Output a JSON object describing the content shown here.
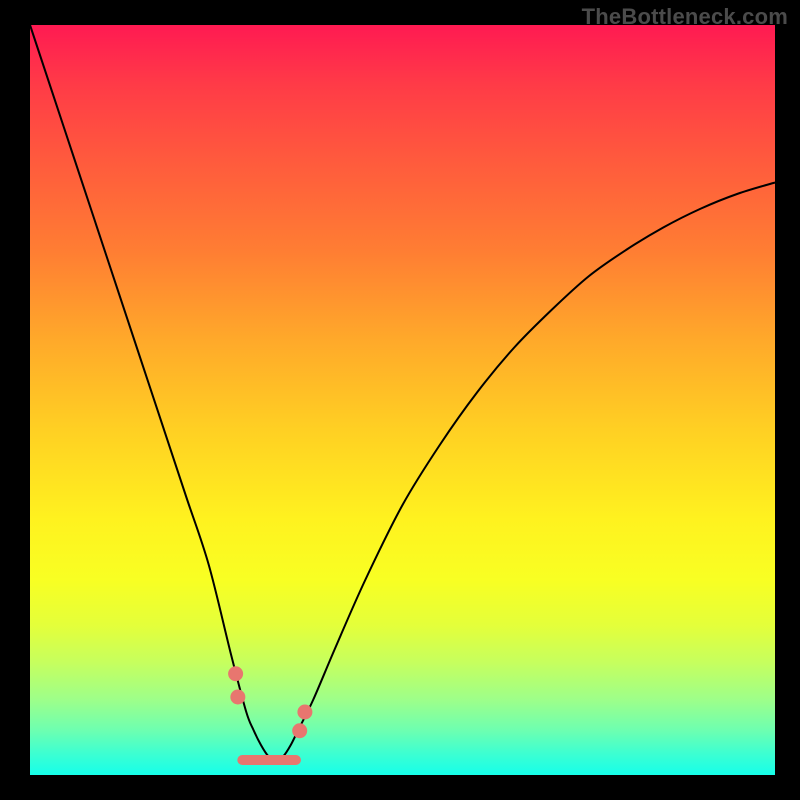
{
  "watermark": "TheBottleneck.com",
  "colors": {
    "frame": "#000000",
    "curve": "#000000",
    "marker": "#e8766f",
    "gradient_top": "#ff1a52",
    "gradient_bottom": "#16ffea"
  },
  "chart_data": {
    "type": "line",
    "title": "",
    "xlabel": "",
    "ylabel": "",
    "xlim": [
      0,
      100
    ],
    "ylim": [
      0,
      100
    ],
    "x": [
      0,
      3,
      6,
      9,
      12,
      15,
      18,
      21,
      24,
      27,
      29,
      30,
      31,
      32,
      33,
      34,
      35,
      36,
      38,
      41,
      45,
      50,
      55,
      60,
      65,
      70,
      75,
      80,
      85,
      90,
      95,
      100
    ],
    "values": [
      100,
      91,
      82,
      73,
      64,
      55,
      46,
      37,
      28,
      16,
      8.5,
      6,
      4,
      2.5,
      2,
      2.5,
      4,
      6,
      10,
      17,
      26,
      36,
      44,
      51,
      57,
      62,
      66.5,
      70,
      73,
      75.5,
      77.5,
      79
    ],
    "markers": {
      "dots_x": [
        27.6,
        27.9,
        36.2,
        36.9
      ],
      "dots_y": [
        13.5,
        10.4,
        5.9,
        8.4
      ],
      "segment": {
        "x0": 28.5,
        "x1": 35.7,
        "y": 2.0
      }
    }
  }
}
